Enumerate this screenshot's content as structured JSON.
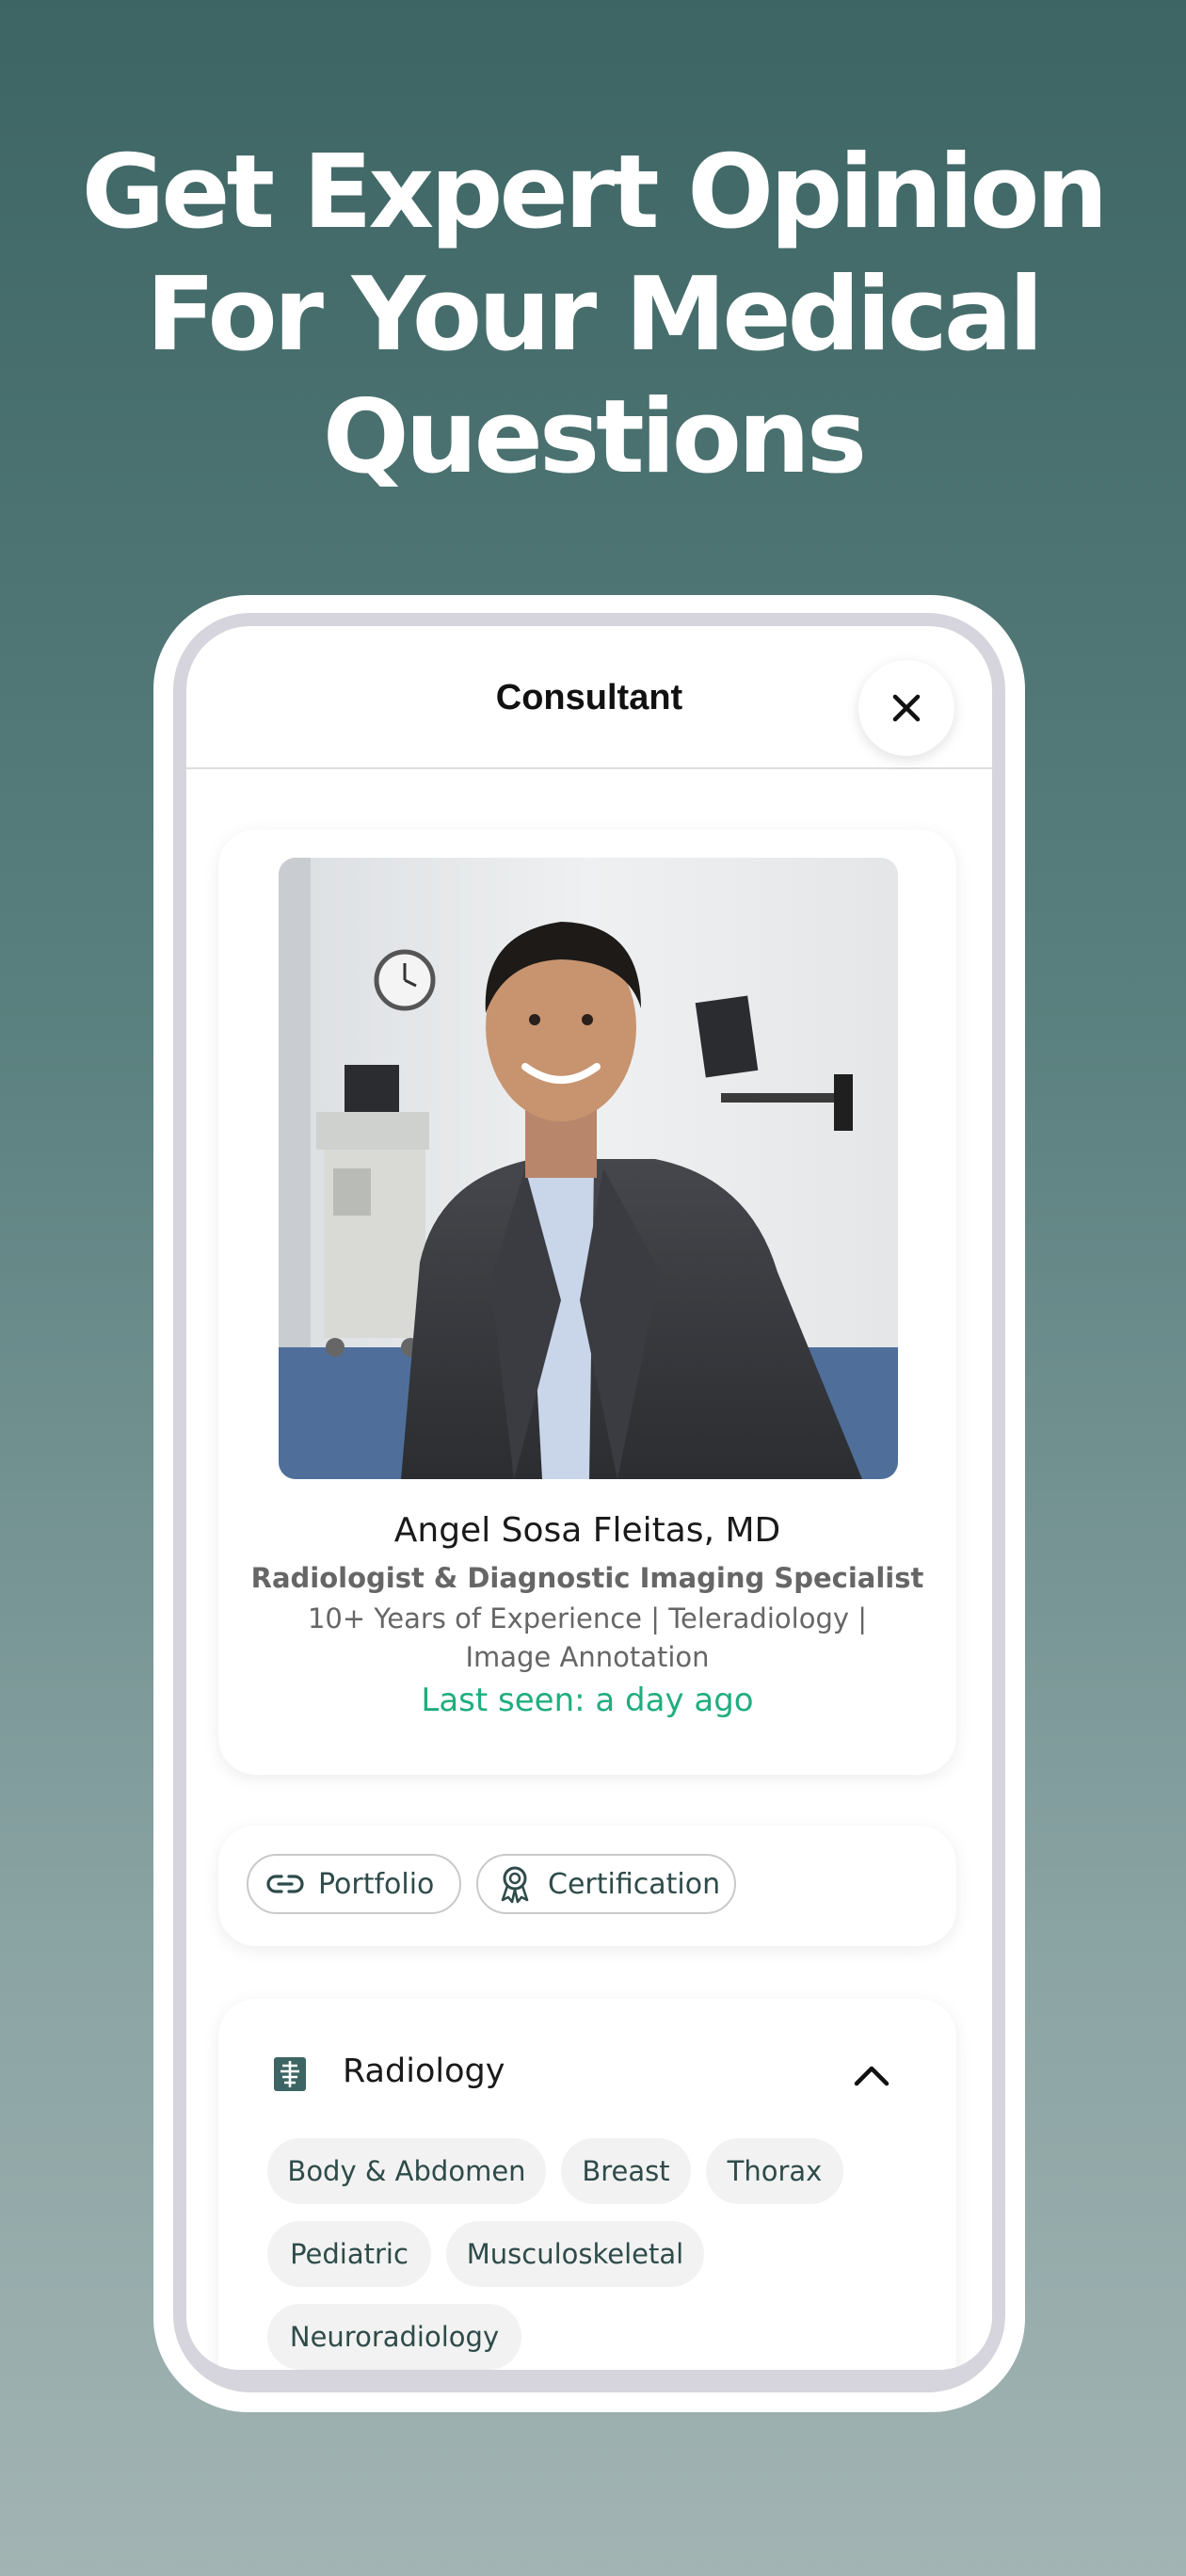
{
  "headline": {
    "line1": "Get Expert Opinion",
    "line2": "For Your Medical",
    "line3": "Questions"
  },
  "nav": {
    "title": "Consultant",
    "close_icon": "close-icon"
  },
  "profile": {
    "name": "Angel Sosa Fleitas, MD",
    "role": "Radiologist & Diagnostic Imaging Specialist",
    "meta": "10+ Years of Experience | Teleradiology | Image Annotation",
    "last_seen": "Last seen: a day ago"
  },
  "links": [
    {
      "label": "Portfolio",
      "icon": "link-icon"
    },
    {
      "label": "Certification",
      "icon": "award-icon"
    }
  ],
  "specialty": {
    "title": "Radiology",
    "icon": "radiology-icon",
    "expanded": true,
    "tags": [
      "Body & Abdomen",
      "Breast",
      "Thorax",
      "Pediatric",
      "Musculoskeletal",
      "Neuroradiology"
    ]
  },
  "colors": {
    "background_top": "#3d6563",
    "background_bottom": "#a2b4b3",
    "accent_green": "#1fae7c",
    "teal_text": "#2e4b4a"
  }
}
